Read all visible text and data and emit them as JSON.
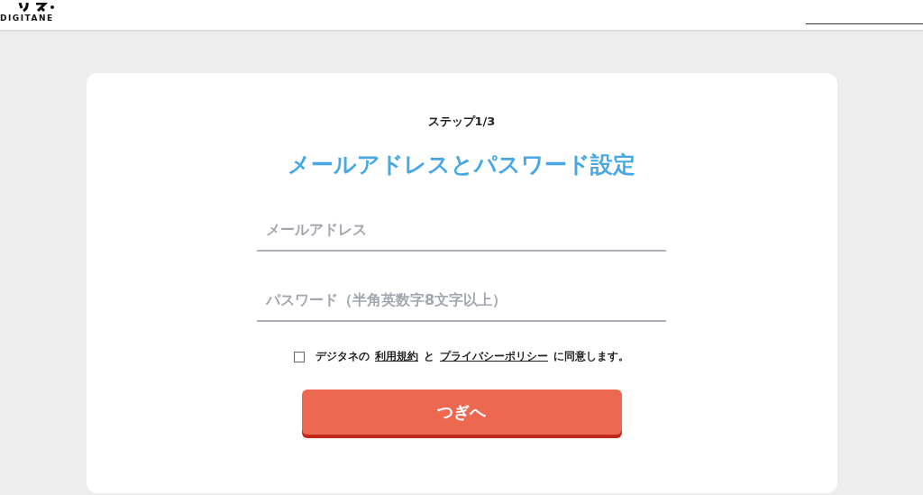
{
  "header": {
    "logo_text": "DIGITANE"
  },
  "form": {
    "step": "ステップ1/3",
    "title": "メールアドレスとパスワード設定",
    "fields": [
      {
        "placeholder": "メールアドレス"
      },
      {
        "placeholder": "パスワード（半角英数字8文字以上）"
      }
    ],
    "agreement": {
      "checked": false,
      "parts": [
        {
          "kind": "text",
          "text": "デジタネの"
        },
        {
          "kind": "link",
          "text": "利用規約"
        },
        {
          "kind": "text",
          "text": "と"
        },
        {
          "kind": "link",
          "text": "プライバシーポリシー"
        },
        {
          "kind": "text",
          "text": "に同意します。"
        }
      ]
    },
    "submit": "つぎへ"
  }
}
